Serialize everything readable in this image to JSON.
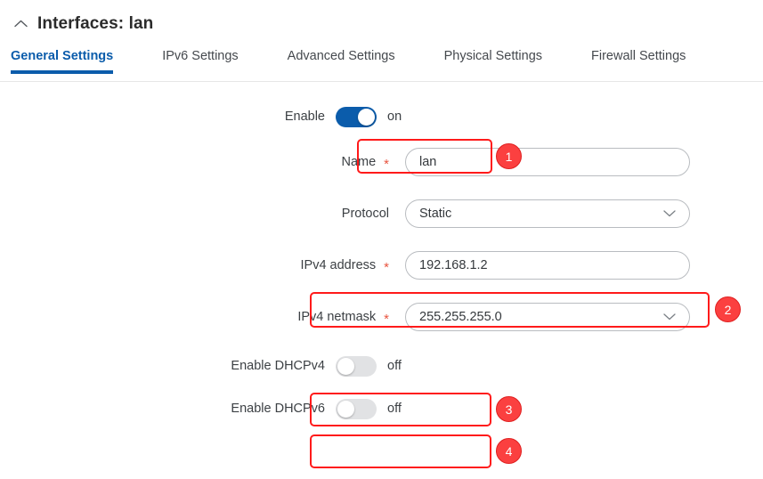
{
  "header": {
    "collapse_icon": "chevron-up-icon",
    "title": "Interfaces: lan"
  },
  "tabs": [
    {
      "label": "General Settings",
      "active": true
    },
    {
      "label": "IPv6 Settings",
      "active": false
    },
    {
      "label": "Advanced Settings",
      "active": false
    },
    {
      "label": "Physical Settings",
      "active": false
    },
    {
      "label": "Firewall Settings",
      "active": false
    }
  ],
  "form": {
    "enable": {
      "label": "Enable",
      "state": "on",
      "required": false
    },
    "name": {
      "label": "Name",
      "value": "lan",
      "required": true
    },
    "protocol": {
      "label": "Protocol",
      "value": "Static",
      "required": false,
      "chevron": "chevron-down-icon"
    },
    "ipv4_address": {
      "label": "IPv4 address",
      "value": "192.168.1.2",
      "required": true
    },
    "ipv4_netmask": {
      "label": "IPv4 netmask",
      "value": "255.255.255.0",
      "required": true,
      "chevron": "chevron-down-icon"
    },
    "dhcpv4": {
      "label": "Enable DHCPv4",
      "state": "off"
    },
    "dhcpv6": {
      "label": "Enable DHCPv6",
      "state": "off"
    },
    "required_marker": "*"
  },
  "annotations": [
    {
      "number": "1",
      "target": "enable-toggle-row"
    },
    {
      "number": "2",
      "target": "ipv4-address-row"
    },
    {
      "number": "3",
      "target": "enable-dhcpv4-row"
    },
    {
      "number": "4",
      "target": "enable-dhcpv6-row"
    }
  ],
  "colors": {
    "accent_blue": "#0b5cab",
    "annotation_red": "#ff1a1a",
    "badge_red": "#fb4040",
    "required_star": "#e8543f",
    "toggle_off": "#e1e2e4"
  }
}
